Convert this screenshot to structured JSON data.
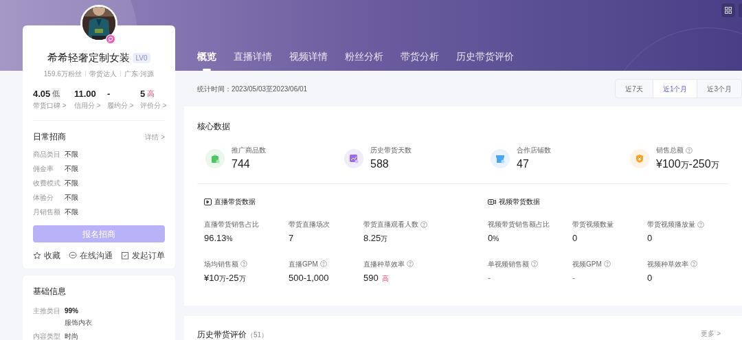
{
  "profile": {
    "name": "希希轻奢定制女装",
    "level": "LV0",
    "meta": [
      "159.6万粉丝",
      "带货达人",
      "广东·河源"
    ],
    "scores": [
      {
        "value": "4.05",
        "tag": {
          "text": "低",
          "kind": "low"
        },
        "label": "带货口碑 >"
      },
      {
        "value": "11.00",
        "label": "信用分 >"
      },
      {
        "value": "-",
        "label": "履约分 >"
      },
      {
        "value": "5",
        "tag": {
          "text": "高",
          "kind": "high"
        },
        "label": "评价分 >"
      }
    ]
  },
  "recruit": {
    "title": "日常招商",
    "detail": "详情 >",
    "rows": [
      {
        "label": "商品类目",
        "value": "不限"
      },
      {
        "label": "佣金率",
        "value": "不限"
      },
      {
        "label": "收费模式",
        "value": "不限"
      },
      {
        "label": "体验分",
        "value": "不限"
      },
      {
        "label": "月销售额",
        "value": "不限"
      }
    ],
    "button": {
      "label": "报名招商",
      "disabled": true
    },
    "actions": [
      {
        "kind": "star",
        "label": "收藏"
      },
      {
        "kind": "chat",
        "label": "在线沟通"
      },
      {
        "kind": "order",
        "label": "发起订单"
      }
    ]
  },
  "basic": {
    "title": "基础信息",
    "rows": [
      {
        "label": "主推类目",
        "value": "99%",
        "note": "服饰内衣"
      },
      {
        "label": "内容类型",
        "value": "时尚"
      }
    ]
  },
  "tabs": [
    {
      "label": "概览",
      "selected": true
    },
    {
      "label": "直播详情",
      "selected": false
    },
    {
      "label": "视频详情",
      "selected": false
    },
    {
      "label": "粉丝分析",
      "selected": false
    },
    {
      "label": "带货分析",
      "selected": false
    },
    {
      "label": "历史带货评价",
      "selected": false
    }
  ],
  "period": {
    "text": "统计时间：2023/05/03至2023/06/01",
    "options": [
      {
        "label": "近7天",
        "selected": false
      },
      {
        "label": "近1个月",
        "selected": true
      },
      {
        "label": "近3个月",
        "selected": false
      }
    ]
  },
  "core": {
    "title": "核心数据",
    "metrics": [
      {
        "kind": "bag",
        "label": "推广商品数",
        "value": [
          {
            "text": "744",
            "kind": "num"
          }
        ]
      },
      {
        "kind": "trend",
        "label": "历史带货天数",
        "value": [
          {
            "text": "588",
            "kind": "num"
          }
        ]
      },
      {
        "kind": "shop",
        "label": "合作店铺数",
        "value": [
          {
            "text": "47",
            "kind": "num"
          }
        ]
      },
      {
        "kind": "coin",
        "label": "销售总额",
        "help": true,
        "value": [
          {
            "text": "¥100",
            "kind": "num"
          },
          {
            "text": "万",
            "kind": "unit"
          },
          {
            "text": "-250",
            "kind": "num"
          },
          {
            "text": "万",
            "kind": "unit"
          }
        ]
      }
    ],
    "sections": [
      {
        "kind": "live",
        "title": "直播带货数据",
        "items": [
          {
            "label": "直播带货销售占比",
            "value": [
              {
                "text": "96.13",
                "kind": "num"
              },
              {
                "text": "%",
                "kind": "unit"
              }
            ]
          },
          {
            "label": "带货直播场次",
            "value": [
              {
                "text": "7",
                "kind": "num"
              }
            ]
          },
          {
            "label": "带货直播观看人数",
            "help": true,
            "value": [
              {
                "text": "8.25",
                "kind": "num"
              },
              {
                "text": "万",
                "kind": "unit"
              }
            ]
          },
          {
            "label": "场均销售额",
            "help": true,
            "value": [
              {
                "text": "¥10",
                "kind": "num"
              },
              {
                "text": "万",
                "kind": "unit"
              },
              {
                "text": "-25",
                "kind": "num"
              },
              {
                "text": "万",
                "kind": "unit"
              }
            ]
          },
          {
            "label": "直播GPM",
            "help": true,
            "value": [
              {
                "text": "500-1,000",
                "kind": "num"
              }
            ]
          },
          {
            "label": "直播种草效率",
            "help": true,
            "value": [
              {
                "text": "590",
                "kind": "num"
              },
              {
                "text": "高",
                "kind": "high"
              }
            ]
          }
        ]
      },
      {
        "kind": "video",
        "title": "视频带货数据",
        "items": [
          {
            "label": "视频带货销售额占比",
            "value": [
              {
                "text": "0",
                "kind": "num"
              },
              {
                "text": "%",
                "kind": "unit"
              }
            ]
          },
          {
            "label": "带货视频数量",
            "value": [
              {
                "text": "0",
                "kind": "num"
              }
            ]
          },
          {
            "label": "带货视频播放量",
            "help": true,
            "value": [
              {
                "text": "0",
                "kind": "num"
              }
            ]
          },
          {
            "label": "单视频销售额",
            "help": true,
            "value": [
              {
                "text": "-",
                "kind": "dash"
              }
            ]
          },
          {
            "label": "视频GPM",
            "help": true,
            "value": [
              {
                "text": "-",
                "kind": "dash"
              }
            ]
          },
          {
            "label": "视频种草效率",
            "help": true,
            "value": [
              {
                "text": "0",
                "kind": "num"
              }
            ]
          }
        ]
      }
    ]
  },
  "reviews": {
    "title": "历史带货评价",
    "count": "（51）",
    "more": "更多 >"
  }
}
